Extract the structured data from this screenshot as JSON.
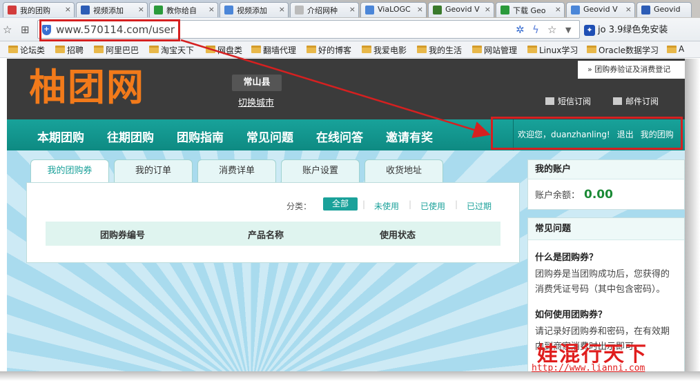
{
  "browser": {
    "tabs": [
      {
        "title": "我的团购",
        "icon_color": "#d23c3c"
      },
      {
        "title": "视频添加",
        "icon_color": "#2d5db6"
      },
      {
        "title": "教你给自",
        "icon_color": "#2b9a3b"
      },
      {
        "title": "视频添加",
        "icon_color": "#4b86d8"
      },
      {
        "title": "介绍网种",
        "icon_color": "#bbbbbb"
      },
      {
        "title": "ViaLOGC",
        "icon_color": "#4b86d8"
      },
      {
        "title": "Geovid V",
        "icon_color": "#3a7a2c"
      },
      {
        "title": "下载 Geo",
        "icon_color": "#2b9a3b"
      },
      {
        "title": "Geovid V",
        "icon_color": "#4b86d8"
      },
      {
        "title": "Geovid",
        "icon_color": "#2d5db6"
      }
    ],
    "tab_close": "×",
    "url": "www.570114.com/user",
    "extension_text": "jo 3.9绿色免安装",
    "bookmarks": [
      "论坛类",
      "招聘",
      "阿里巴巴",
      "淘宝天下",
      "网盘类",
      "翻墙代理",
      "好的博客",
      "我爱电影",
      "我的生活",
      "网站管理",
      "Linux学习",
      "Oracle数据学习",
      "A"
    ]
  },
  "site": {
    "logo": "柚团网",
    "city": "常山县",
    "switch_city": "切换城市",
    "verify_link": "» 团购券验证及消费登记",
    "sms_subscribe": "短信订阅",
    "email_subscribe": "邮件订阅",
    "nav": [
      "本期团购",
      "往期团购",
      "团购指南",
      "常见问题",
      "在线问答",
      "邀请有奖"
    ],
    "welcome": "欢迎您，duanzhanling!",
    "logout": "退出",
    "my_group": "我的团购"
  },
  "account": {
    "tabs": [
      "我的团购券",
      "我的订单",
      "消费详单",
      "账户设置",
      "收货地址"
    ],
    "active_tab": 0,
    "filter_label": "分类：",
    "filters": [
      "全部",
      "未使用",
      "已使用",
      "已过期"
    ],
    "active_filter": 0,
    "columns": [
      "团购券编号",
      "产品名称",
      "使用状态"
    ]
  },
  "sidebar": {
    "account_title": "我的账户",
    "balance_label": "账户余额：",
    "balance_value": "0.00",
    "faq_title": "常见问题",
    "faq": [
      {
        "q": "什么是团购券？",
        "a": "团购券是当团购成功后，您获得的消费凭证号码（其中包含密码）。"
      },
      {
        "q": "如何使用团购券？",
        "a": "请记录好团购券和密码，在有效期内到商家消费时出示即可。"
      }
    ]
  },
  "watermark": {
    "text": "娃混行天下",
    "url": "http://www.lianni.com"
  },
  "colors": {
    "accent": "#1aa19a",
    "highlight": "#d52020",
    "logo": "#f27a1a"
  }
}
